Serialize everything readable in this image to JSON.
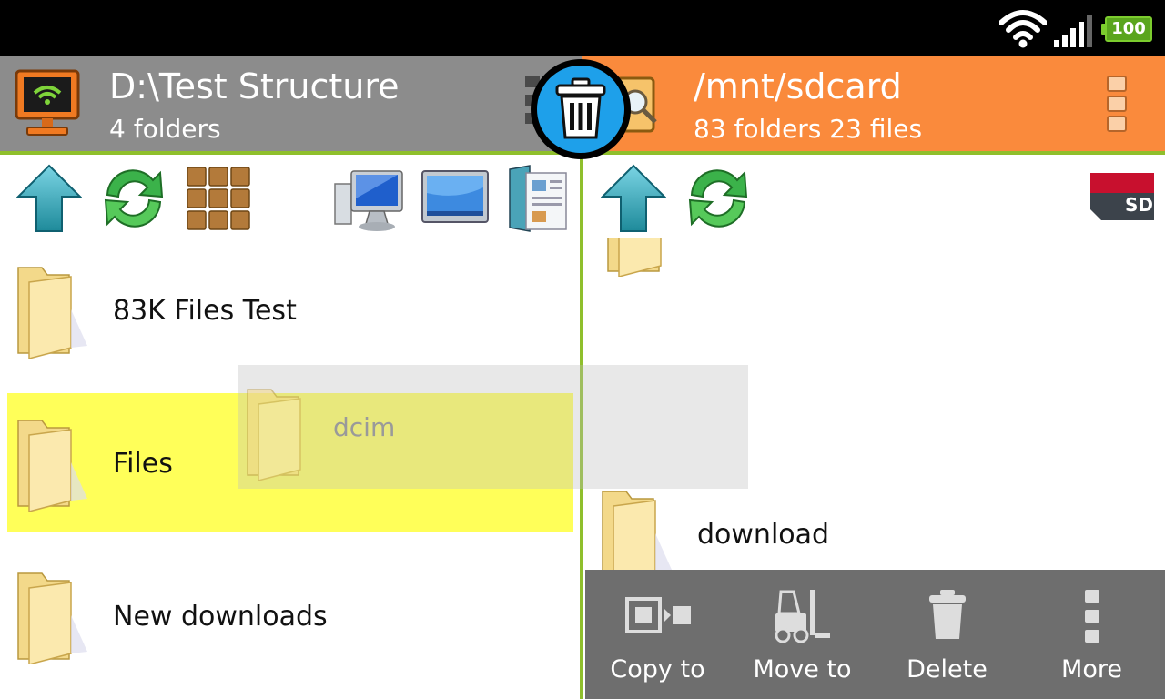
{
  "status_bar": {
    "battery_level": "100",
    "icons": [
      "wifi-icon",
      "signal-icon",
      "battery-icon"
    ]
  },
  "left_pane": {
    "title": "D:\\Test Structure",
    "subtitle": "4 folders",
    "items": [
      {
        "name": "83K Files Test",
        "icon": "folder-icon"
      },
      {
        "name": "Files",
        "icon": "folder-icon",
        "highlighted": true
      },
      {
        "name": "New downloads",
        "icon": "folder-icon"
      }
    ],
    "header_color": "#8c8c8c"
  },
  "right_pane": {
    "title": "/mnt/sdcard",
    "subtitle": "83 folders 23 files",
    "items": [
      {
        "name": "download",
        "icon": "folder-icon"
      }
    ],
    "header_color": "#fa8a3c",
    "storage_badge": "SD"
  },
  "drag": {
    "item_name": "dcim"
  },
  "actions": [
    {
      "label": "Copy to",
      "icon": "copy-to-icon"
    },
    {
      "label": "Move to",
      "icon": "forklift-icon"
    },
    {
      "label": "Delete",
      "icon": "trash-icon"
    },
    {
      "label": "More",
      "icon": "more-vertical-icon"
    }
  ],
  "colors": {
    "accent_green": "#8fbf2c",
    "highlight_yellow": "#ffff59",
    "trash_blue": "#1ea0ea",
    "action_bar": "#6e6e6e"
  }
}
